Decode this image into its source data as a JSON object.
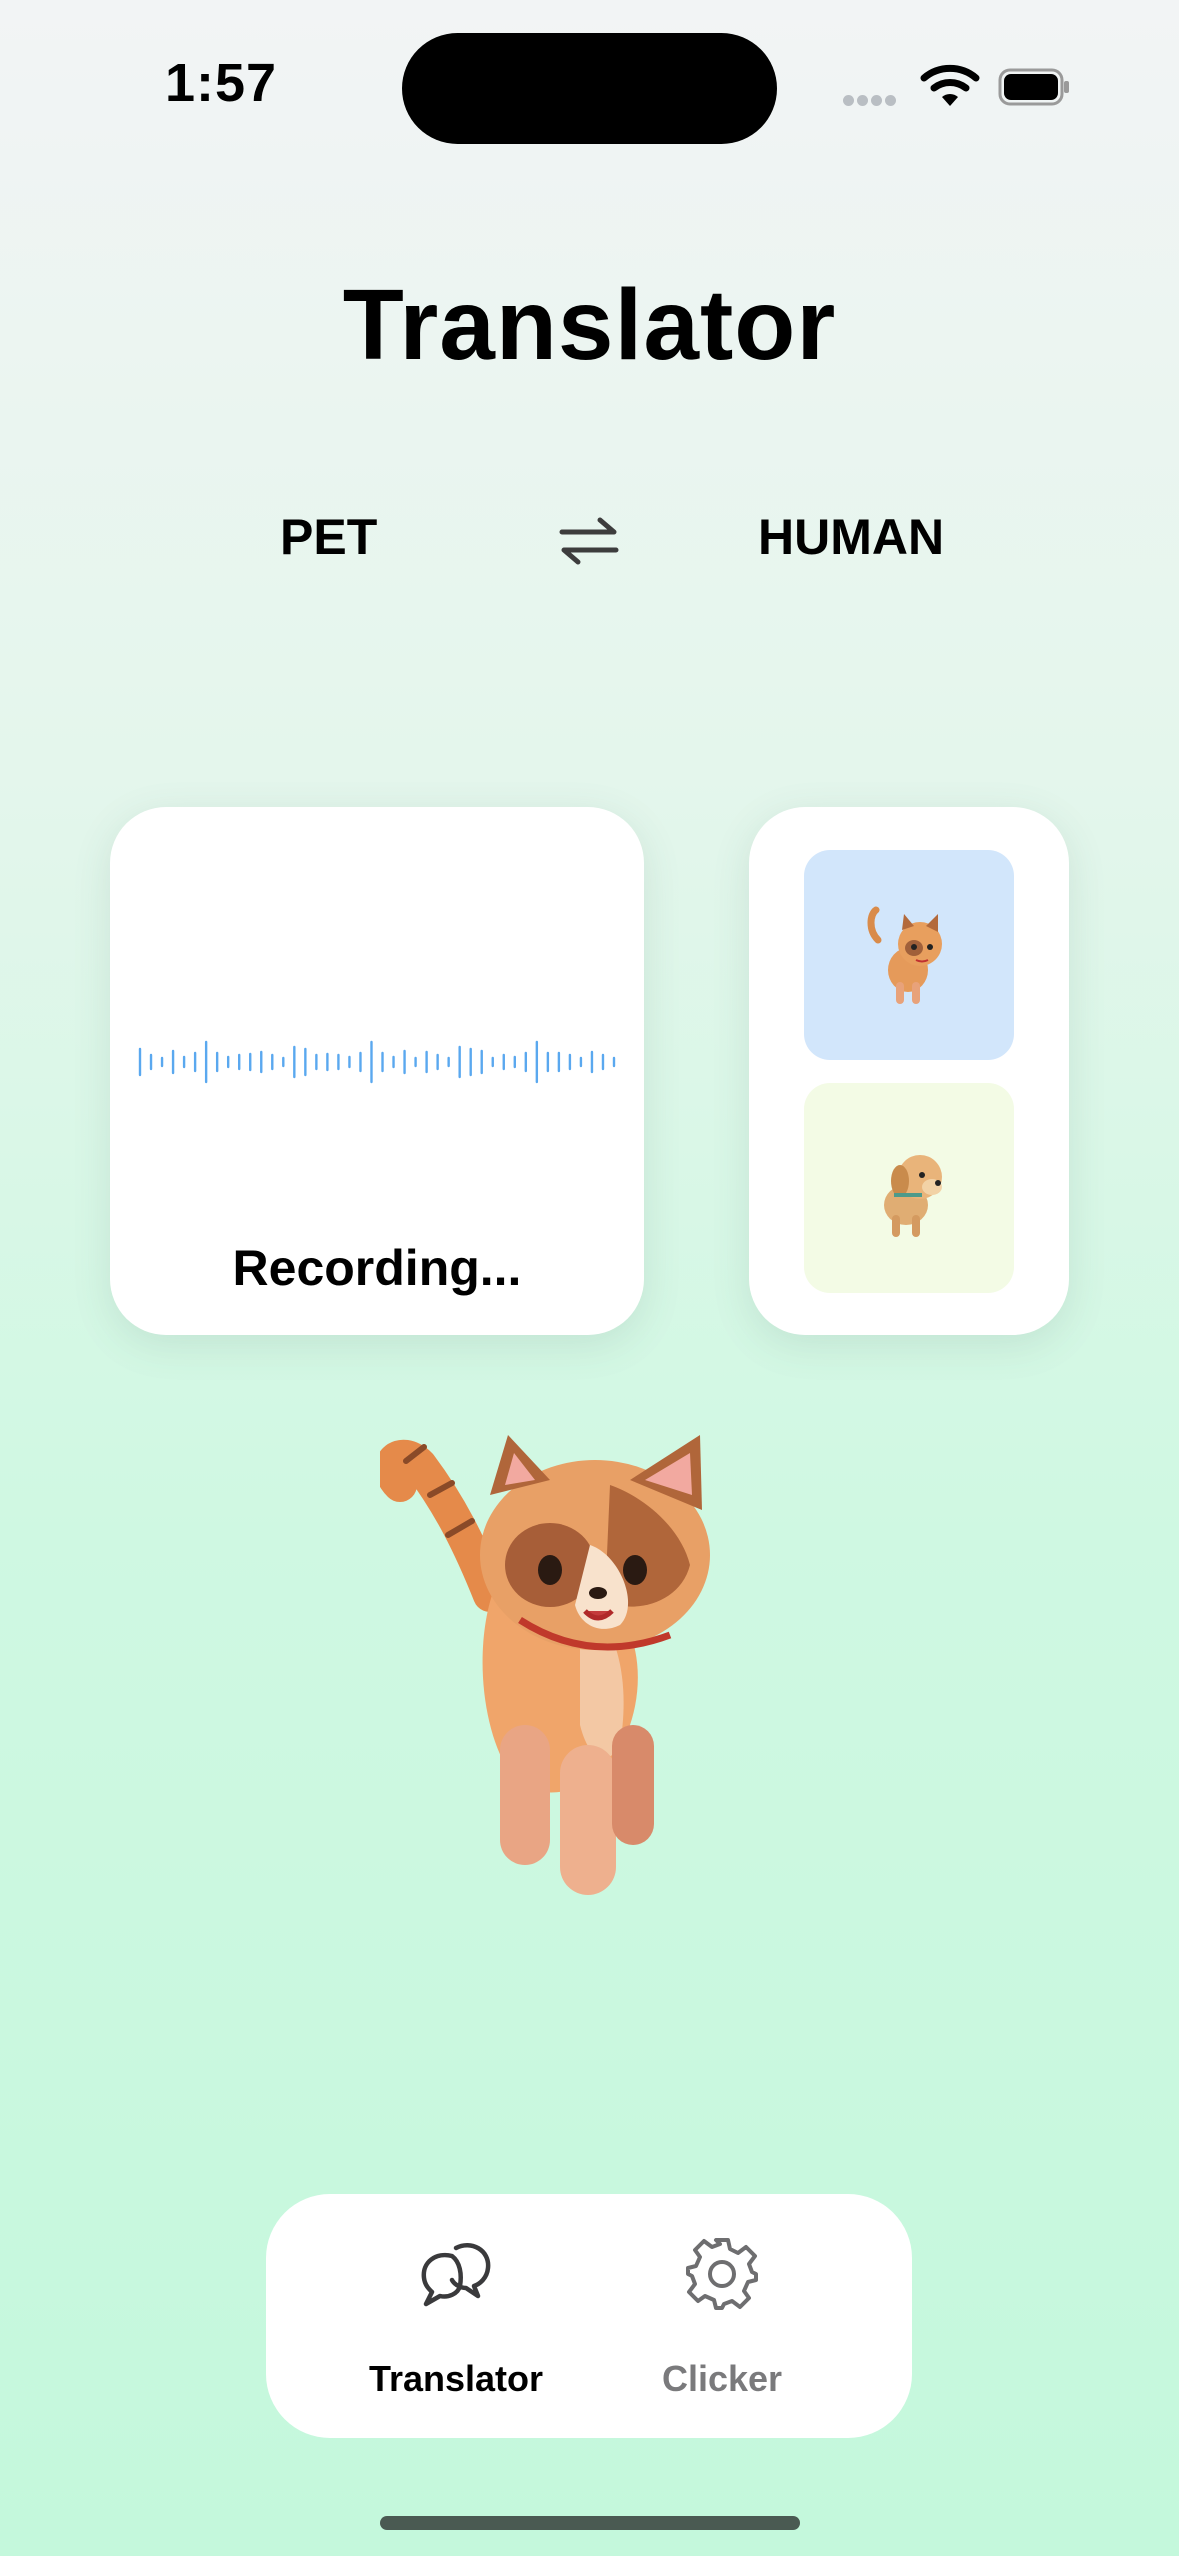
{
  "status": {
    "time": "1:57"
  },
  "header": {
    "title": "Translator"
  },
  "languages": {
    "from": "PET",
    "to": "HUMAN",
    "swap_icon": "swap-arrows-icon"
  },
  "recorder": {
    "label": "Recording...",
    "accent": "#5aa8ef"
  },
  "pets": {
    "items": [
      {
        "name": "cat",
        "bg": "#d2e6fb"
      },
      {
        "name": "dog",
        "bg": "#f3fbe5"
      }
    ]
  },
  "tabbar": {
    "items": [
      {
        "label": "Translator",
        "icon": "chat-bubbles-icon",
        "active": true
      },
      {
        "label": "Clicker",
        "icon": "gear-icon",
        "active": false
      }
    ]
  }
}
